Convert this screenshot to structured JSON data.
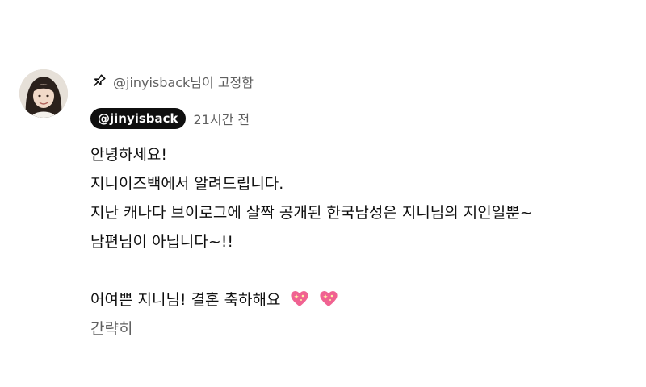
{
  "comment": {
    "pinned_text": "@jinyisback님이 고정함",
    "author": "@jinyisback",
    "timestamp": "21시간 전",
    "lines": [
      "안녕하세요!",
      "지니이즈백에서 알려드립니다.",
      "지난 캐나다 브이로그에 살짝 공개된 한국남성은 지니님의 지인일뿐~",
      "남편님이 아닙니다~!!",
      "",
      "어여쁜 지니님! 결혼 축하해요",
      "간략히"
    ],
    "emoji": [
      "sparkling-heart-icon",
      "sparkling-heart-icon"
    ],
    "colors": {
      "chip_bg": "#0f0f0f",
      "meta_text": "#606060",
      "heart": "#f06292"
    }
  }
}
